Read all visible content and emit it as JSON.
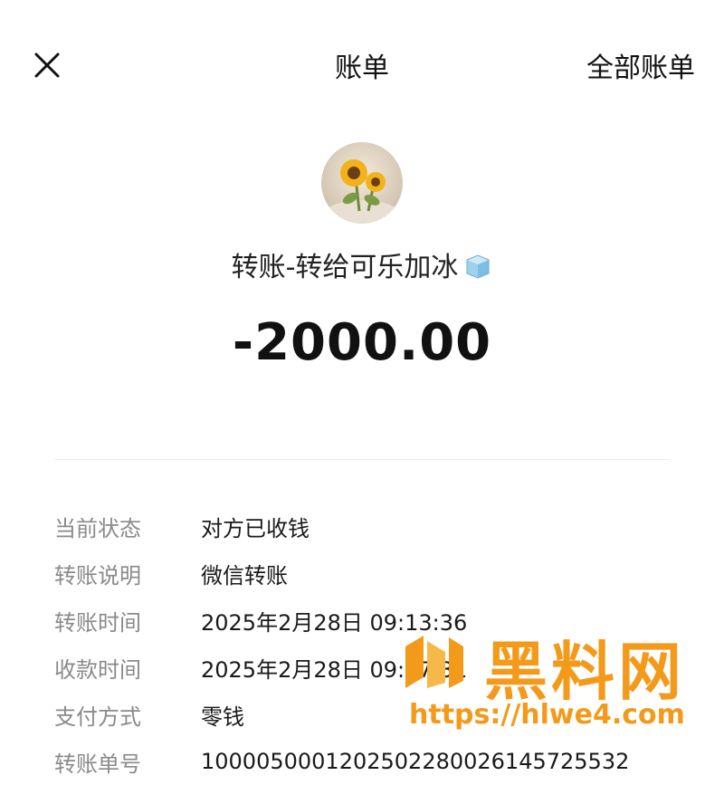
{
  "header": {
    "title": "账单",
    "all_bills_label": "全部账单"
  },
  "payee": {
    "title": "转账-转给可乐加冰",
    "emoji": "ice-cube"
  },
  "amount": "-2000.00",
  "details": {
    "rows": [
      {
        "label": "当前状态",
        "value": "对方已收钱"
      },
      {
        "label": "转账说明",
        "value": "微信转账"
      },
      {
        "label": "转账时间",
        "value": "2025年2月28日 09:13:36"
      },
      {
        "label": "收款时间",
        "value": "2025年2月28日 09:17:31"
      },
      {
        "label": "支付方式",
        "value": "零钱"
      },
      {
        "label": "转账单号",
        "value": "1000050001202502280026145725532"
      }
    ]
  },
  "watermark": {
    "brand": "黑料网",
    "url": "https://hlwe4.com",
    "color": "#f39a1b"
  }
}
